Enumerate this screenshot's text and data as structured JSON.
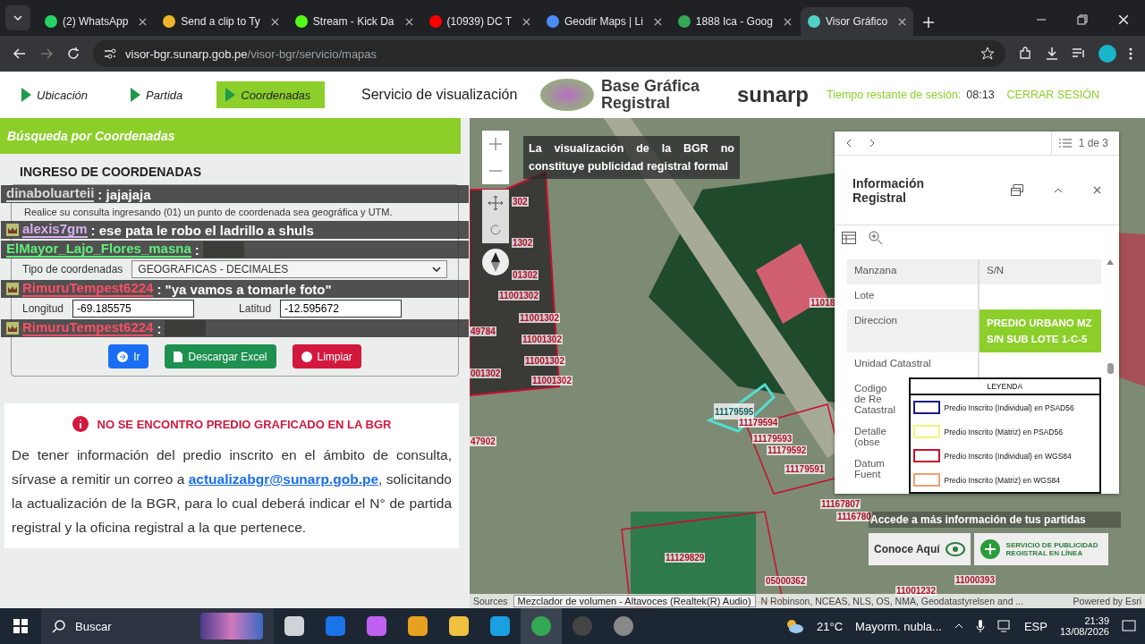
{
  "browser": {
    "tabs": [
      {
        "title": "(2) WhatsApp",
        "kind": "whatsapp",
        "selected": false
      },
      {
        "title": "Send a clip to Ty",
        "kind": "clip",
        "selected": false
      },
      {
        "title": "Stream - Kick Da",
        "kind": "kick",
        "selected": false
      },
      {
        "title": "(10939) DC T",
        "kind": "youtube",
        "selected": false
      },
      {
        "title": "Geodir Maps | Li",
        "kind": "pin",
        "selected": false
      },
      {
        "title": "1888 Ica - Goog",
        "kind": "maps",
        "selected": false
      },
      {
        "title": "Visor Gráfico",
        "kind": "visor",
        "selected": true
      }
    ],
    "url_host": "visor-bgr.sunarp.gob.pe",
    "url_path": "/visor-bgr/servicio/mapas"
  },
  "header": {
    "nav": [
      {
        "label": "Ubicación",
        "selected": false
      },
      {
        "label": "Partida",
        "selected": false
      },
      {
        "label": "Coordenadas",
        "selected": true
      }
    ],
    "title": "Servicio de visualización",
    "logo_line1": "Base Gráfica",
    "logo_line2": "Registral",
    "brand": "sunarp",
    "session_label": "Tiempo restante de sesión:",
    "session_time": "08:13",
    "logout": "CERRAR SESIÓN"
  },
  "search_panel": {
    "title": "Búsqueda por Coordenadas",
    "heading": "INGRESO DE COORDENADAS",
    "hint": "Realice su consulta ingresando (01) un punto de coordenada sea geográfica y UTM.",
    "type_label": "Tipo de coordenadas",
    "type_value": "GEOGRAFICAS - DECIMALES",
    "longitude_label": "Longitud",
    "longitude_value": "-69.185575",
    "latitude_label": "Latitud",
    "latitude_value": "-12.595672",
    "buttons": [
      {
        "label": "Ir",
        "kind": "go"
      },
      {
        "label": "Descargar Excel",
        "kind": "excel"
      },
      {
        "label": "Limpiar",
        "kind": "clear"
      }
    ]
  },
  "chat": [
    {
      "user": "dinaboluarteii",
      "text": ": jajajaja",
      "color": "#d8d8d8",
      "badge": false,
      "emote": false
    },
    {
      "user": "alexis7gm",
      "text": ": ese pata le robo el ladrillo a shuls",
      "color": "#d8b0f0",
      "badge": true,
      "emote": false
    },
    {
      "user": "ElMayor_Lajo_Flores_masna",
      "text": ":",
      "color": "#5ef07a",
      "badge": false,
      "emote": true
    },
    {
      "user": "RimuruTempest6224",
      "text": ": \"ya vamos a tomarle foto\"",
      "color": "#ff4d66",
      "badge": true,
      "emote": false
    },
    {
      "user": "RimuruTempest6224",
      "text": ":",
      "color": "#ff4d66",
      "badge": true,
      "emote": true
    }
  ],
  "notice": {
    "title": "NO SE ENCONTRO PREDIO GRAFICADO EN LA BGR",
    "before": "De tener información del predio inscrito en el ámbito de consulta, sírvase a remitir un correo a ",
    "email": "actualizabgr@sunarp.gob.pe",
    "after": ", solicitando la actualización de la BGR, para lo cual deberá indicar el N° de partida registral y la oficina registral a la que pertenece."
  },
  "map": {
    "disclaimer": "La visualización de la BGR no constituye publicidad registral formal",
    "parcel_labels": [
      {
        "text": "302",
        "kind": "normal"
      },
      {
        "text": "1302",
        "kind": "normal"
      },
      {
        "text": "01302",
        "kind": "normal"
      },
      {
        "text": "11001302",
        "kind": "normal"
      },
      {
        "text": "11001302",
        "kind": "normal"
      },
      {
        "text": "11001302",
        "kind": "normal"
      },
      {
        "text": "11001302",
        "kind": "normal"
      },
      {
        "text": "11001302",
        "kind": "normal"
      },
      {
        "text": "49784",
        "kind": "normal"
      },
      {
        "text": "001302",
        "kind": "normal"
      },
      {
        "text": "47902",
        "kind": "normal"
      },
      {
        "text": "11179595",
        "kind": "selected"
      },
      {
        "text": "11179594",
        "kind": "normal"
      },
      {
        "text": "11179593",
        "kind": "normal"
      },
      {
        "text": "11179592",
        "kind": "normal"
      },
      {
        "text": "11179591",
        "kind": "normal"
      },
      {
        "text": "11018",
        "kind": "normal"
      },
      {
        "text": "11167807",
        "kind": "normal"
      },
      {
        "text": "1116780",
        "kind": "normal"
      },
      {
        "text": "11129829",
        "kind": "normal"
      },
      {
        "text": "05000362",
        "kind": "normal"
      },
      {
        "text": "11001232",
        "kind": "normal"
      },
      {
        "text": "11000393",
        "kind": "normal"
      }
    ],
    "popup": {
      "counter": "1 de 3",
      "title_line1": "Información",
      "title_line2": "Registral",
      "rows": [
        {
          "label": "Manzana",
          "value": "S/N",
          "highlighted": false
        },
        {
          "label": "Lote",
          "value": "",
          "highlighted": false
        },
        {
          "label": "Direccion",
          "value": "PREDIO URBANO MZ S/N SUB LOTE 1-C-5",
          "highlighted": true
        },
        {
          "label": "Unidad Catastral",
          "value": "",
          "highlighted": false
        }
      ],
      "cut_rows": [
        "Codigo de Re\nCatastral",
        "Detalle (obse",
        "Datum Fuent"
      ]
    },
    "legend": {
      "title": "LEYENDA",
      "items": [
        {
          "label": "Predio Inscrito (Individual) en PSAD56",
          "color": "#1a1a8c"
        },
        {
          "label": "Predio Inscrito (Matriz) en PSAD56",
          "color": "#f5f57a"
        },
        {
          "label": "Predio Inscrito (Individual) en WGS84",
          "color": "#c8102e"
        },
        {
          "label": "Predio Inscrito (Matriz) en WGS84",
          "color": "#f0a070"
        }
      ]
    },
    "banner": {
      "title": "Accede a más información de tus partidas",
      "cta": "Conoce Aquí",
      "service": "SERVICIO DE PUBLICIDAD REGISTRAL EN LÍNEA"
    },
    "attribution": {
      "sources": "Sources",
      "credits": "N Robinson, NCEAS, NLS, OS, NMA, Geodatastyrelsen and ...",
      "powered": "Powered by Esri"
    },
    "tooltip": "Mezclador de volumen - Altavoces (Realtek(R) Audio)"
  },
  "taskbar": {
    "search": "Buscar",
    "temperature": "21°C",
    "weather": "Mayorm. nubla...",
    "language": "ESP",
    "time": "21:39",
    "date": "13/08/2026"
  }
}
